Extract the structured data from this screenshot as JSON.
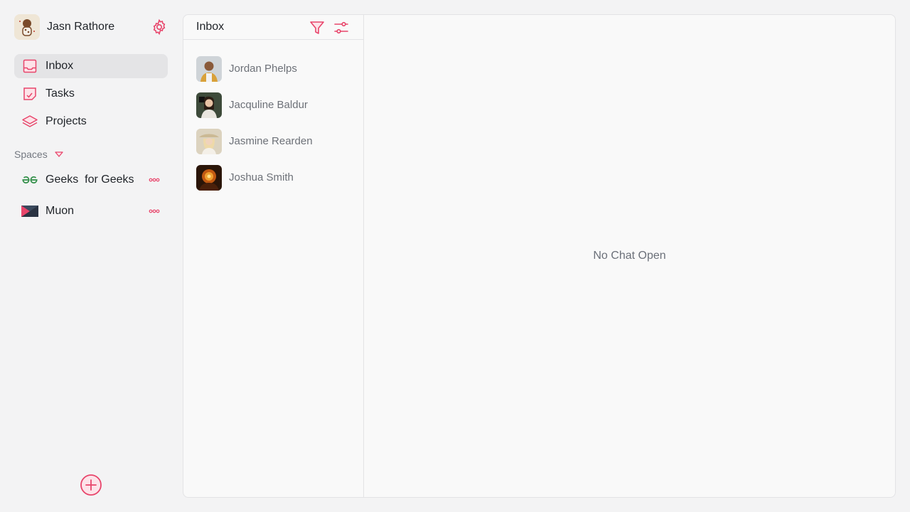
{
  "user": {
    "name": "Jasn Rathore"
  },
  "nav": {
    "items": [
      {
        "label": "Inbox",
        "icon": "inbox-icon",
        "active": true
      },
      {
        "label": "Tasks",
        "icon": "tasks-icon",
        "active": false
      },
      {
        "label": "Projects",
        "icon": "layers-icon",
        "active": false
      }
    ]
  },
  "spaces": {
    "header": "Spaces",
    "items": [
      {
        "label": "Geeks  for Geeks",
        "icon": "gfg-logo-icon"
      },
      {
        "label": "Muon",
        "icon": "muon-logo-icon"
      }
    ]
  },
  "inbox": {
    "title": "Inbox",
    "chats": [
      {
        "name": "Jordan Phelps",
        "avatar_color": "#b58b5a"
      },
      {
        "name": "Jacquline Baldur",
        "avatar_color": "#3d4a3a"
      },
      {
        "name": "Jasmine Rearden",
        "avatar_color": "#cdbb9a"
      },
      {
        "name": "Joshua Smith",
        "avatar_color": "#5a2a10"
      }
    ]
  },
  "chat": {
    "empty_message": "No Chat Open"
  },
  "colors": {
    "accent": "#e8456b",
    "gfg_green": "#2f8d46",
    "muon_dark": "#2a3342"
  }
}
